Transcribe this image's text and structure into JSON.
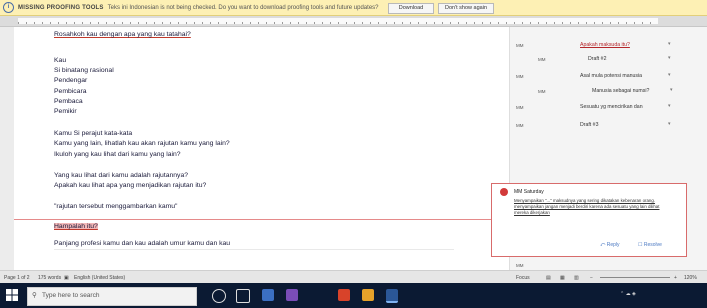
{
  "infobar": {
    "title": "MISSING PROOFING TOOLS",
    "message": "Teks ini Indonesian is not being checked. Do you want to download proofing tools and future updates?",
    "download_label": "Download",
    "dont_ask_label": "Don't show again"
  },
  "document": {
    "lines": [
      "Rosahkoh kau dengan apa yang kau tatahai?",
      "Kau",
      "Si binatang rasional",
      "Pendengar",
      "Pembicara",
      "Pembaca",
      "Pemikir",
      "Kamu Si perajut kata-kata",
      "Kamu yang lain, lihatlah kau akan rajutan kamu yang lain?",
      "Ikuloh yang kau lihat dari kamu yang lain?",
      "Yang kau lihat dari kamu adalah rajutannya?",
      "Apakah kau lihat apa yang menjadikan rajutan itu?",
      "\"rajutan tersebut menggambarkan kamu\"",
      "Hampalah itu?",
      "Panjang profesi kamu dan kau adalah umur kamu dan kau"
    ]
  },
  "markup": {
    "items": [
      {
        "tag": "MM",
        "text": "Apakah maksuda itu?"
      },
      {
        "tag": "MM",
        "text": "Draft #2"
      },
      {
        "tag": "MM",
        "text": "Asal mula potensi manusia"
      },
      {
        "tag": "MM",
        "text": "Manusia sebagai numsi?"
      },
      {
        "tag": "MM",
        "text": "Sesuatu yg mencirikan dan"
      },
      {
        "tag": "MM",
        "text": "Draft #3"
      }
    ],
    "bottom_tag": "MM"
  },
  "comment": {
    "author": "MM",
    "time": "Saturday",
    "body": "Menyampaikan \"...\" maksudnya yang sering dikatakan kebenaran orang. menyampaikan jangan menjadi berdiri karena ada sesuatu yang lain dilihat mereka dikerjakan",
    "reply_label": "Reply",
    "resolve_label": "Resolve"
  },
  "status": {
    "page": "Page 1 of 2",
    "words": "175 words",
    "language": "English (United States)",
    "focus": "Focus",
    "zoom": "120%"
  },
  "taskbar": {
    "search_placeholder": "Type here to search"
  },
  "colors": {
    "infobar_bg": "#fdf0b4",
    "accent_red": "#d23a3a",
    "taskbar": "#0b1a33"
  }
}
